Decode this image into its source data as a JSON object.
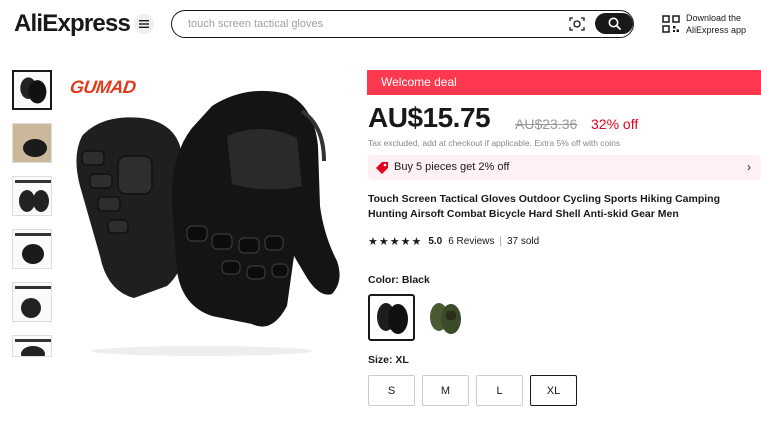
{
  "header": {
    "logo_text": "AliExpress",
    "search_placeholder": "touch screen tactical gloves",
    "download_line1": "Download the",
    "download_line2": "AliExpress app",
    "icons": [
      "menu-icon",
      "camera-search-icon",
      "search-icon",
      "qr-code-icon"
    ]
  },
  "gallery": {
    "brand_logo": "GUMAD",
    "thumbnail_count": 6,
    "selected_thumbnail": 0
  },
  "product": {
    "welcome_deal": "Welcome deal",
    "price": "AU$15.75",
    "original_price": "AU$23.36",
    "discount": "32% off",
    "tax_note": "Tax excluded, add at checkout if applicable. Extra 5% off with coins",
    "bundle_offer": "Buy 5 pieces get 2% off",
    "title": "Touch Screen Tactical Gloves Outdoor Cycling Sports Hiking Camping Hunting Airsoft Combat Bicycle Hard Shell Anti-skid Gear Men",
    "stars": "★★★★★",
    "rating": "5.0",
    "reviews": "6 Reviews",
    "sep": "|",
    "sold": "37 sold",
    "color_label": "Color: Black",
    "colors": [
      "Black",
      "Green"
    ],
    "selected_color": "Black",
    "size_label": "Size: XL",
    "sizes": [
      "S",
      "M",
      "L",
      "XL"
    ],
    "selected_size": "XL"
  },
  "colors": {
    "accent": "#fd384f",
    "discount_red": "#e1001e",
    "bundle_bg": "#fff1f3",
    "text": "#191919"
  }
}
